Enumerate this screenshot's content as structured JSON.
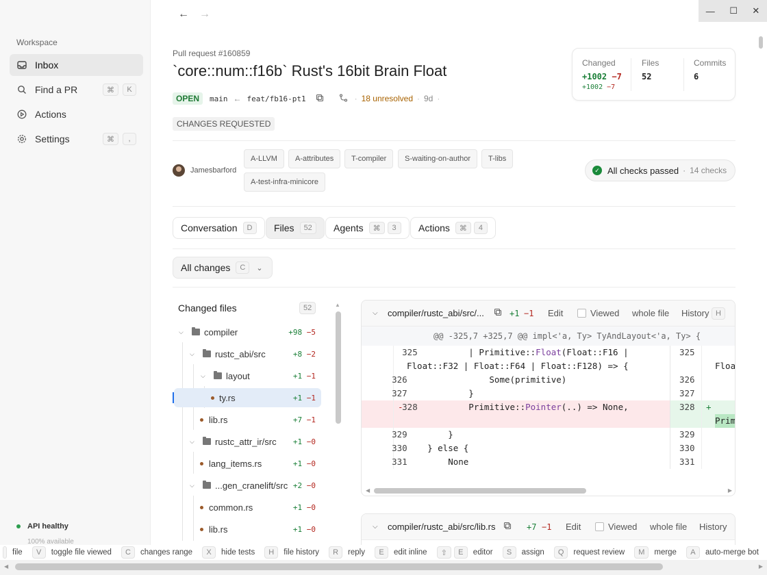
{
  "sidebar": {
    "section_label": "Workspace",
    "items": [
      {
        "label": "Inbox",
        "icon": "inbox-icon",
        "keys": []
      },
      {
        "label": "Find a PR",
        "icon": "search-icon",
        "keys": [
          "⌘",
          "K"
        ]
      },
      {
        "label": "Actions",
        "icon": "play-icon",
        "keys": []
      },
      {
        "label": "Settings",
        "icon": "gear-icon",
        "keys": [
          "⌘",
          ","
        ]
      }
    ],
    "api_status": "API healthy",
    "api_sub": "100% available"
  },
  "window": {
    "minimize": "—",
    "maximize": "☐",
    "close": "✕"
  },
  "nav": {
    "back": "←",
    "forward": "→"
  },
  "pr": {
    "number_label": "Pull request #160859",
    "title": "`core::num::f16b` Rust's 16bit Brain Float",
    "state": "OPEN",
    "base_branch": "main",
    "head_branch": "feat/fb16-pt1",
    "unresolved": "18 unresolved",
    "age": "9d",
    "review_state": "CHANGES REQUESTED",
    "author": "Jamesbarford",
    "labels": [
      "A-LLVM",
      "A-attributes",
      "T-compiler",
      "S-waiting-on-author",
      "T-libs",
      "A-test-infra-minicore"
    ]
  },
  "stats": {
    "changed_label": "Changed",
    "changed_add": "+1002",
    "changed_del": "−7",
    "changed_sub_add": "+1002",
    "changed_sub_del": "−7",
    "files_label": "Files",
    "files_value": "52",
    "commits_label": "Commits",
    "commits_value": "6"
  },
  "checks": {
    "label": "All checks passed",
    "count": "14 checks"
  },
  "tabs": [
    {
      "label": "Conversation",
      "key": "D"
    },
    {
      "label": "Files",
      "key": "52"
    },
    {
      "label": "Agents",
      "key": "⌘",
      "key2": "3"
    },
    {
      "label": "Actions",
      "key": "⌘",
      "key2": "4"
    }
  ],
  "filter": {
    "label": "All changes",
    "key": "C"
  },
  "tree": {
    "title": "Changed files",
    "count": "52",
    "rows": [
      {
        "type": "folder",
        "name": "compiler",
        "add": "+98",
        "del": "−5"
      },
      {
        "type": "folder",
        "name": "rustc_abi/src",
        "add": "+8",
        "del": "−2"
      },
      {
        "type": "folder",
        "name": "layout",
        "add": "+1",
        "del": "−1"
      },
      {
        "type": "file",
        "name": "ty.rs",
        "add": "+1",
        "del": "−1"
      },
      {
        "type": "file",
        "name": "lib.rs",
        "add": "+7",
        "del": "−1"
      },
      {
        "type": "folder",
        "name": "rustc_attr_ir/src",
        "add": "+1",
        "del": "−0"
      },
      {
        "type": "file",
        "name": "lang_items.rs",
        "add": "+1",
        "del": "−0"
      },
      {
        "type": "folder",
        "name": "...gen_cranelift/src",
        "add": "+2",
        "del": "−0"
      },
      {
        "type": "file",
        "name": "common.rs",
        "add": "+1",
        "del": "−0"
      },
      {
        "type": "file",
        "name": "lib.rs",
        "add": "+1",
        "del": "−0"
      }
    ]
  },
  "diff1": {
    "path": "compiler/rustc_abi/src/...",
    "add": "+1",
    "del": "−1",
    "edit": "Edit",
    "viewed": "Viewed",
    "whole_file": "whole file",
    "history": "History",
    "history_key": "H",
    "hunk": "@@ -325,7 +325,7 @@ impl<'a, Ty> TyAndLayout<'a, Ty> {",
    "lines": {
      "l325": "325",
      "l325_code_a": "            | Primitive::",
      "l325_code_b": "Float",
      "l325_code_c": "(Float::F16 |",
      "l325_cont": "Float::F32 | Float::F64 | Float::F128) => {",
      "r325_cont": "Floa",
      "l326": "326",
      "l326_code": "                Some(primitive)",
      "l327": "327",
      "l327_code": "            }",
      "l328": "328",
      "l328_sign": "-",
      "l328_code_a": "            Primitive::",
      "l328_code_b": "Pointer",
      "l328_code_c": "(..) => None,",
      "r328_sign": "+",
      "r328_cont": "Prim",
      "l329": "329",
      "l329_code": "        }",
      "l330": "330",
      "l330_code": "    } else {",
      "l331": "331",
      "l331_code": "        None"
    }
  },
  "diff2": {
    "path": "compiler/rustc_abi/src/lib.rs",
    "add": "+7",
    "del": "−1",
    "edit": "Edit",
    "viewed": "Viewed",
    "whole_file": "whole file",
    "history": "History"
  },
  "shortcuts": [
    {
      "key": "",
      "label": "file"
    },
    {
      "key": "V",
      "label": "toggle file viewed"
    },
    {
      "key": "C",
      "label": "changes range"
    },
    {
      "key": "X",
      "label": "hide tests"
    },
    {
      "key": "H",
      "label": "file history"
    },
    {
      "key": "R",
      "label": "reply"
    },
    {
      "key": "E",
      "label": "edit inline"
    },
    {
      "key": "⇧",
      "key2": "E",
      "label": "editor"
    },
    {
      "key": "S",
      "label": "assign"
    },
    {
      "key": "Q",
      "label": "request review"
    },
    {
      "key": "M",
      "label": "merge"
    },
    {
      "key": "A",
      "label": "auto-merge bot"
    }
  ]
}
